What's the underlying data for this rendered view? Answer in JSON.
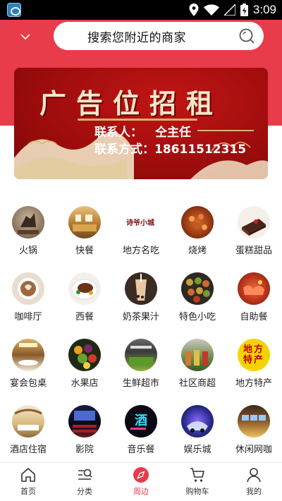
{
  "status_bar": {
    "time": "3:09"
  },
  "search": {
    "placeholder": "搜索您附近的商家"
  },
  "banner": {
    "title": "广告位招租",
    "contact_label": "联系人：",
    "contact_name": "仝主任",
    "phone_label": "联系方式：",
    "phone": "18611512315"
  },
  "categories": [
    {
      "label": "火锅"
    },
    {
      "label": "快餐"
    },
    {
      "label": "地方名吃"
    },
    {
      "label": "烧烤"
    },
    {
      "label": "蛋糕甜品"
    },
    {
      "label": "咖啡厅"
    },
    {
      "label": "西餐"
    },
    {
      "label": "奶茶果汁"
    },
    {
      "label": "特色小吃"
    },
    {
      "label": "自助餐"
    },
    {
      "label": "宴会包桌"
    },
    {
      "label": "水果店"
    },
    {
      "label": "生鲜超市"
    },
    {
      "label": "社区商超"
    },
    {
      "label": "地方特产"
    },
    {
      "label": "酒店住宿"
    },
    {
      "label": "影院"
    },
    {
      "label": "音乐餐"
    },
    {
      "label": "娱乐城"
    },
    {
      "label": "休闲网咖"
    }
  ],
  "category_texts": {
    "local_brand": "诗爷小城",
    "specialty_badge": "地方特产",
    "music_sign": "酒"
  },
  "nav": [
    {
      "label": "首页",
      "icon": "home-icon"
    },
    {
      "label": "分类",
      "icon": "category-icon"
    },
    {
      "label": "周边",
      "icon": "nearby-icon"
    },
    {
      "label": "购物车",
      "icon": "cart-icon"
    },
    {
      "label": "我的",
      "icon": "profile-icon"
    }
  ],
  "colors": {
    "accent": "#e83c4a",
    "banner_red": "#9c0c0c",
    "banner_gold": "#f6e7c9"
  }
}
